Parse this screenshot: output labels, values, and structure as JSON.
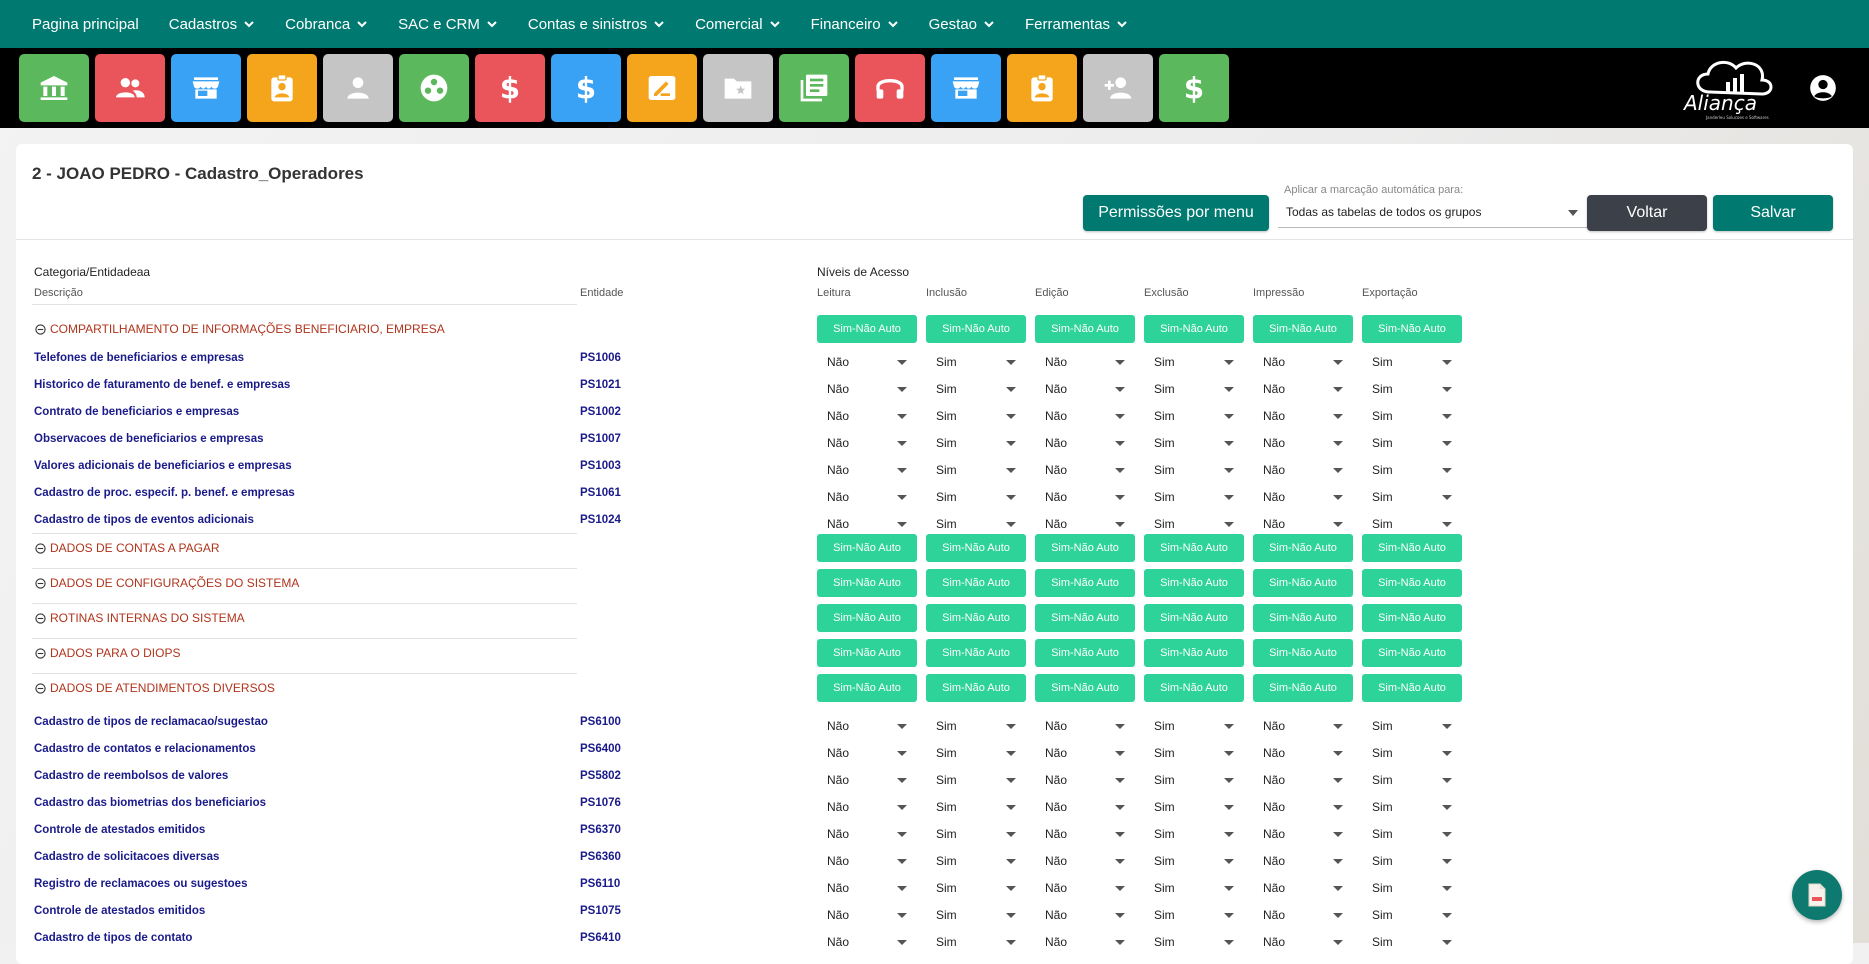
{
  "nav": {
    "items": [
      {
        "label": "Pagina principal",
        "dropdown": false
      },
      {
        "label": "Cadastros",
        "dropdown": true
      },
      {
        "label": "Cobranca",
        "dropdown": true
      },
      {
        "label": "SAC e CRM",
        "dropdown": true
      },
      {
        "label": "Contas e sinistros",
        "dropdown": true
      },
      {
        "label": "Comercial",
        "dropdown": true
      },
      {
        "label": "Financeiro",
        "dropdown": true
      },
      {
        "label": "Gestao",
        "dropdown": true
      },
      {
        "label": "Ferramentas",
        "dropdown": true
      }
    ]
  },
  "toolbar": {
    "tiles": [
      {
        "icon": "bank-icon",
        "color": "#5cb85c"
      },
      {
        "icon": "users-icon",
        "color": "#e9555a"
      },
      {
        "icon": "store-icon",
        "color": "#3aa2f4"
      },
      {
        "icon": "badge-icon",
        "color": "#f4a51c"
      },
      {
        "icon": "person-icon",
        "color": "#c5c5c5"
      },
      {
        "icon": "group-circle-icon",
        "color": "#5cb85c"
      },
      {
        "icon": "dollar-icon",
        "color": "#e9555a"
      },
      {
        "icon": "dollar-icon",
        "color": "#3aa2f4"
      },
      {
        "icon": "edit-note-icon",
        "color": "#f4a51c"
      },
      {
        "icon": "folder-star-icon",
        "color": "#c5c5c5"
      },
      {
        "icon": "library-books-icon",
        "color": "#5cb85c"
      },
      {
        "icon": "headset-icon",
        "color": "#e9555a"
      },
      {
        "icon": "store-icon",
        "color": "#3aa2f4"
      },
      {
        "icon": "badge-icon",
        "color": "#f4a51c"
      },
      {
        "icon": "person-add-icon",
        "color": "#c5c5c5"
      },
      {
        "icon": "dollar-icon",
        "color": "#5cb85c"
      }
    ],
    "logo_text": "Aliança",
    "logo_sub": "Janderleu Solucoes e Softwares"
  },
  "page": {
    "title": "2 - JOAO PEDRO - Cadastro_Operadores",
    "perm_button": "Permissões por menu",
    "auto_label": "Aplicar a marcação automática para:",
    "auto_value": "Todas as tabelas de todos os grupos",
    "back_button": "Voltar",
    "save_button": "Salvar"
  },
  "table": {
    "cat_header": "Categoria/Entidadeaa",
    "desc_header": "Descrição",
    "entity_header": "Entidade",
    "levels_header": "Níveis de Acesso",
    "level_columns": [
      "Leitura",
      "Inclusão",
      "Edição",
      "Exclusão",
      "Impressão",
      "Exportação"
    ],
    "auto_label": "Sim-Não Auto",
    "rows": [
      {
        "type": "cat",
        "label": "COMPARTILHAMENTO DE INFORMAÇÕES BENEFICIARIO, EMPRESA"
      },
      {
        "type": "ent",
        "desc": "Telefones de beneficiarios e empresas",
        "code": "PS1006",
        "vals": [
          "Não",
          "Sim",
          "Não",
          "Sim",
          "Não",
          "Sim"
        ]
      },
      {
        "type": "ent",
        "desc": "Historico de faturamento de benef. e empresas",
        "code": "PS1021",
        "vals": [
          "Não",
          "Sim",
          "Não",
          "Sim",
          "Não",
          "Sim"
        ]
      },
      {
        "type": "ent",
        "desc": "Contrato de beneficiarios e empresas",
        "code": "PS1002",
        "vals": [
          "Não",
          "Sim",
          "Não",
          "Sim",
          "Não",
          "Sim"
        ]
      },
      {
        "type": "ent",
        "desc": "Observacoes de beneficiarios e empresas",
        "code": "PS1007",
        "vals": [
          "Não",
          "Sim",
          "Não",
          "Sim",
          "Não",
          "Sim"
        ]
      },
      {
        "type": "ent",
        "desc": "Valores adicionais de beneficiarios e empresas",
        "code": "PS1003",
        "vals": [
          "Não",
          "Sim",
          "Não",
          "Sim",
          "Não",
          "Sim"
        ]
      },
      {
        "type": "ent",
        "desc": "Cadastro de proc. especif. p. benef. e empresas",
        "code": "PS1061",
        "vals": [
          "Não",
          "Sim",
          "Não",
          "Sim",
          "Não",
          "Sim"
        ]
      },
      {
        "type": "ent",
        "desc": "Cadastro de tipos de eventos adicionais",
        "code": "PS1024",
        "vals": [
          "Não",
          "Sim",
          "Não",
          "Sim",
          "Não",
          "Sim"
        ]
      },
      {
        "type": "cat",
        "label": "DADOS DE CONTAS A PAGAR"
      },
      {
        "type": "cat",
        "label": "DADOS DE CONFIGURAÇÕES DO SISTEMA"
      },
      {
        "type": "cat",
        "label": "ROTINAS INTERNAS DO SISTEMA"
      },
      {
        "type": "cat",
        "label": "DADOS PARA O DIOPS"
      },
      {
        "type": "cat",
        "label": "DADOS DE ATENDIMENTOS DIVERSOS"
      },
      {
        "type": "ent",
        "desc": "Cadastro de tipos de reclamacao/sugestao",
        "code": "PS6100",
        "vals": [
          "Não",
          "Sim",
          "Não",
          "Sim",
          "Não",
          "Sim"
        ]
      },
      {
        "type": "ent",
        "desc": "Cadastro de contatos e relacionamentos",
        "code": "PS6400",
        "vals": [
          "Não",
          "Sim",
          "Não",
          "Sim",
          "Não",
          "Sim"
        ]
      },
      {
        "type": "ent",
        "desc": "Cadastro de reembolsos de valores",
        "code": "PS5802",
        "vals": [
          "Não",
          "Sim",
          "Não",
          "Sim",
          "Não",
          "Sim"
        ]
      },
      {
        "type": "ent",
        "desc": "Cadastro das biometrias dos beneficiarios",
        "code": "PS1076",
        "vals": [
          "Não",
          "Sim",
          "Não",
          "Sim",
          "Não",
          "Sim"
        ]
      },
      {
        "type": "ent",
        "desc": "Controle de atestados emitidos",
        "code": "PS6370",
        "vals": [
          "Não",
          "Sim",
          "Não",
          "Sim",
          "Não",
          "Sim"
        ]
      },
      {
        "type": "ent",
        "desc": "Cadastro de solicitacoes diversas",
        "code": "PS6360",
        "vals": [
          "Não",
          "Sim",
          "Não",
          "Sim",
          "Não",
          "Sim"
        ]
      },
      {
        "type": "ent",
        "desc": "Registro de reclamacoes ou sugestoes",
        "code": "PS6110",
        "vals": [
          "Não",
          "Sim",
          "Não",
          "Sim",
          "Não",
          "Sim"
        ]
      },
      {
        "type": "ent",
        "desc": "Controle de atestados emitidos",
        "code": "PS1075",
        "vals": [
          "Não",
          "Sim",
          "Não",
          "Sim",
          "Não",
          "Sim"
        ]
      },
      {
        "type": "ent",
        "desc": "Cadastro de tipos de contato",
        "code": "PS6410",
        "vals": [
          "Não",
          "Sim",
          "Não",
          "Sim",
          "Não",
          "Sim"
        ]
      }
    ]
  },
  "fab": {
    "icon": "report-icon"
  }
}
